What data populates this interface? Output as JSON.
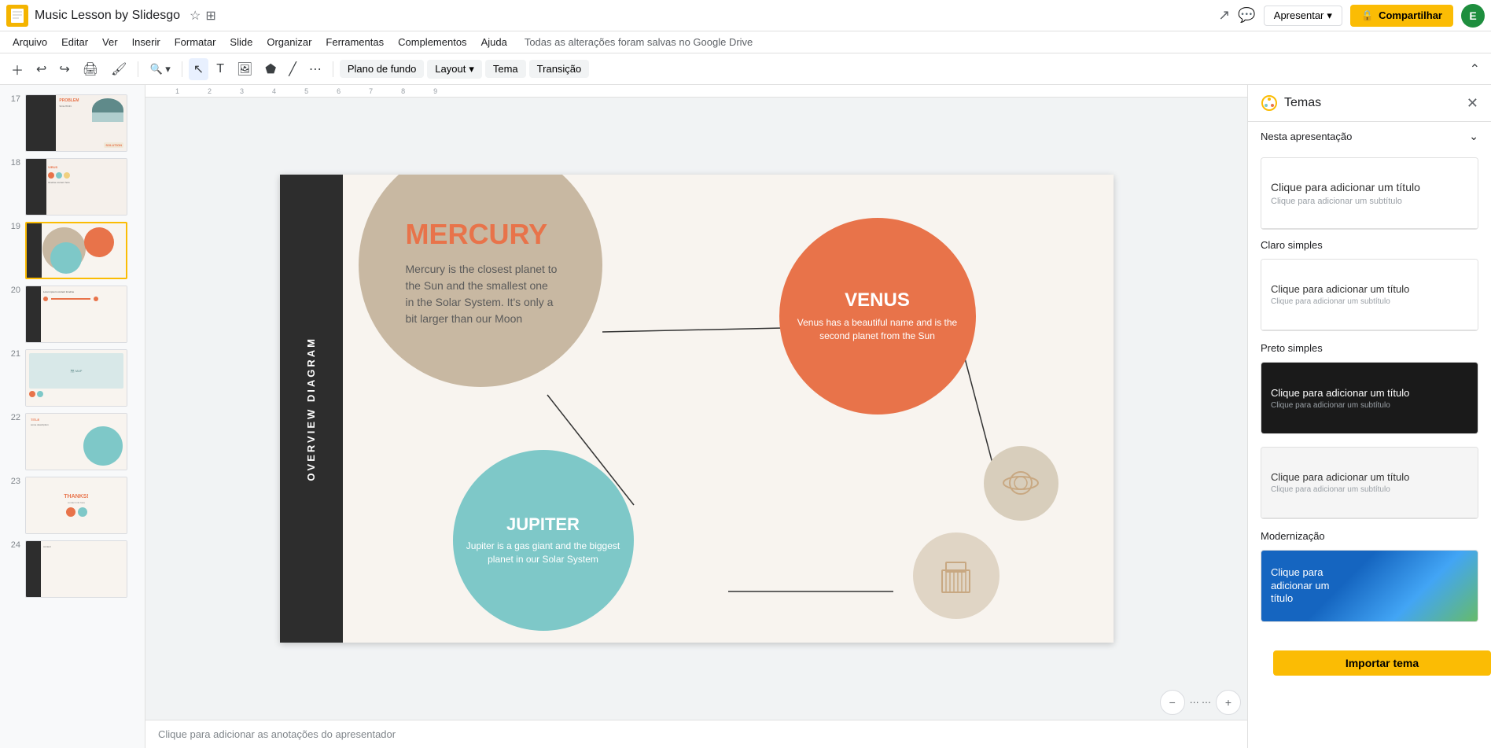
{
  "app": {
    "title": "Music Lesson by Slidesgo",
    "saved_text": "Todas as alterações foram salvas no Google Drive"
  },
  "topbar": {
    "present_label": "Apresentar",
    "share_label": "Compartilhar",
    "avatar_letter": "E",
    "lock_icon": "🔒"
  },
  "menu": {
    "items": [
      "Arquivo",
      "Editar",
      "Ver",
      "Inserir",
      "Formatar",
      "Slide",
      "Organizar",
      "Ferramentas",
      "Complementos",
      "Ajuda"
    ]
  },
  "toolbar": {
    "background_label": "Plano de fundo",
    "layout_label": "Layout",
    "theme_label": "Tema",
    "transition_label": "Transição"
  },
  "slide": {
    "left_bar_text": "OVERVIEW DIAGRAM",
    "mercury_title": "MERCURY",
    "mercury_desc": "Mercury is the closest planet to the Sun and the smallest one in the Solar System. It's only a bit larger than our Moon",
    "venus_title": "VENUS",
    "venus_desc": "Venus has a beautiful name and is the second planet from the Sun",
    "jupiter_title": "JUPITER",
    "jupiter_desc": "Jupiter is a gas giant and the biggest planet in our Solar System"
  },
  "slides": [
    {
      "num": "17"
    },
    {
      "num": "18"
    },
    {
      "num": "19"
    },
    {
      "num": "20"
    },
    {
      "num": "21"
    },
    {
      "num": "22"
    },
    {
      "num": "23"
    },
    {
      "num": "24"
    }
  ],
  "themes": {
    "panel_title": "Temas",
    "section_label": "Nesta apresentação",
    "theme1": {
      "label": "Clique para adicionar um título",
      "subtitle": "Clique para adicionar um subtítulo",
      "card_label": "Claro simples"
    },
    "theme2": {
      "label": "Clique para adicionar um título",
      "subtitle": "Clique para adicionar um subtítulo",
      "card_label": "Preto simples"
    },
    "theme3": {
      "label": "Clique para adicionar um título",
      "subtitle": "Clique para adicionar um subtítulo",
      "card_label": ""
    },
    "theme4": {
      "label": "Clique para",
      "label2": "adicionar um",
      "label3": "título",
      "card_label": "Modernização"
    },
    "import_label": "Importar tema"
  },
  "notes": {
    "placeholder": "Clique para adicionar as anotações do apresentador"
  }
}
